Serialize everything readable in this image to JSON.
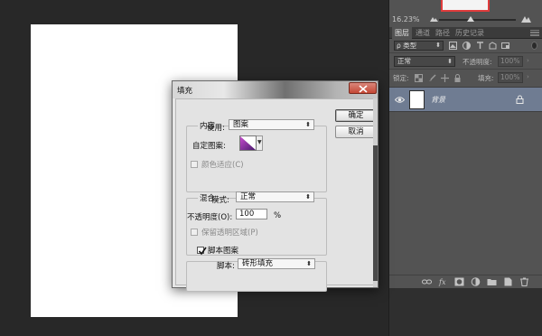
{
  "navigator": {
    "zoom": "16.23%",
    "icons": [
      "small-mountain-icon",
      "large-mountain-icon"
    ]
  },
  "layers_panel": {
    "tabs": [
      {
        "label": "图层",
        "active": true
      },
      {
        "label": "通道",
        "active": false
      },
      {
        "label": "路径",
        "active": false
      },
      {
        "label": "历史记录",
        "active": false
      }
    ],
    "filter": {
      "label": "ρ 类型"
    },
    "blend_mode": "正常",
    "opacity_label": "不透明度:",
    "opacity_value": "100%",
    "lock_label": "锁定:",
    "fill_label": "填充:",
    "fill_value": "100%",
    "layer": {
      "name": "背景",
      "locked": true,
      "visible": true
    },
    "bottom_icons": [
      "link-icon",
      "fx-icon",
      "mask-icon",
      "adjustment-icon",
      "folder-icon",
      "new-layer-icon",
      "trash-icon"
    ]
  },
  "fill_dialog": {
    "title": "填充",
    "content_group": {
      "title": "内容",
      "use_label": "使用:",
      "use_value": "图案",
      "custom_pattern_label": "自定图案:",
      "color_adapt_label": "颜色适应(C)",
      "color_adapt_checked": false
    },
    "blend_group": {
      "title": "混合",
      "mode_label": "模式:",
      "mode_value": "正常",
      "opacity_label": "不透明度(O):",
      "opacity_value": "100",
      "opacity_unit": "%",
      "preserve_label": "保留透明区域(P)",
      "preserve_checked": false
    },
    "script_group": {
      "title": "脚本图案",
      "checked": true,
      "script_label": "脚本:",
      "script_value": "砖形填充"
    },
    "buttons": {
      "ok": "确定",
      "cancel": "取消"
    }
  },
  "colors": {
    "workspace": "#282828",
    "panel": "#535353",
    "layer_selected": "#6f7c92",
    "close_button": "#c54835",
    "dialog_bg": "#e3e3e3"
  }
}
